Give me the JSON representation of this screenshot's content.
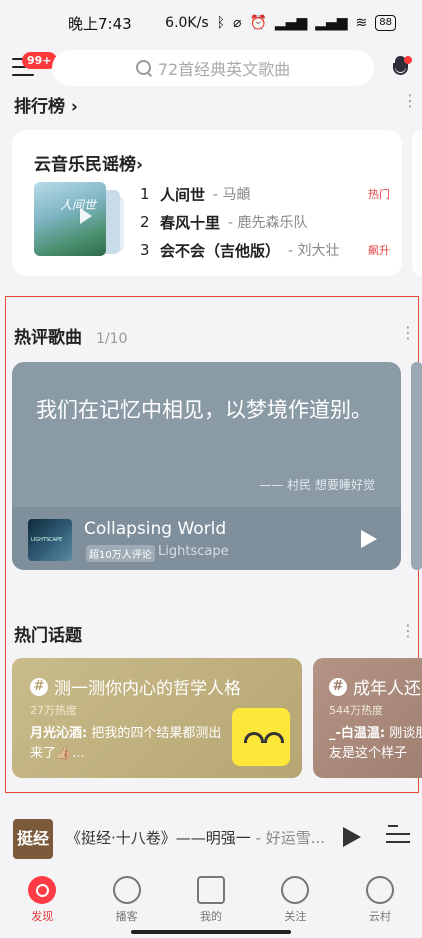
{
  "status": {
    "time": "晚上7:43",
    "speed": "6.0K/s",
    "battery": "88",
    "icons": [
      "bluetooth-icon",
      "mute-icon",
      "alarm-icon",
      "signal-icon",
      "signal-icon",
      "wifi-icon"
    ]
  },
  "header": {
    "badge": "99+",
    "search_placeholder": "72首经典英文歌曲"
  },
  "ranking": {
    "section_title": "排行榜 ›",
    "card_title": "云音乐民谣榜›",
    "cover_text": "人间世",
    "rows": [
      {
        "num": "1",
        "song": "人间世",
        "artist": "- 马頔",
        "tag": "热门"
      },
      {
        "num": "2",
        "song": "春风十里",
        "artist": "- 鹿先森乐队",
        "tag": ""
      },
      {
        "num": "3",
        "song": "会不会（吉他版）",
        "artist": "- 刘大壮",
        "tag": "飙升"
      }
    ]
  },
  "hot_comments": {
    "title": "热评歌曲",
    "page": "1/10",
    "comment": "我们在记忆中相见，以梦境作道别。",
    "author": "—— 村民 想要睡好觉",
    "song_title": "Collapsing World",
    "song_badge": "超10万人评论",
    "song_artist": "Lightscape"
  },
  "hot_topics": {
    "title": "热门话题",
    "cards": [
      {
        "title": "测一测你内心的哲学人格",
        "heat": "27万热度",
        "user": "月光沁酒:",
        "comment": "把我的四个结果都测出来了👍🏼..."
      },
      {
        "title": "成年人还",
        "heat": "544万热度",
        "user": "_-白温温:",
        "comment": "刚谈朋友是这个样子"
      }
    ]
  },
  "player": {
    "cover_text": "挺经",
    "title": "《挺经·十八卷》——明强一",
    "artist": " - 好运雪..."
  },
  "tabs": [
    {
      "label": "发现",
      "active": true
    },
    {
      "label": "播客",
      "active": false
    },
    {
      "label": "我的",
      "active": false
    },
    {
      "label": "关注",
      "active": false
    },
    {
      "label": "云村",
      "active": false
    }
  ],
  "colors": {
    "accent": "#ff3b45",
    "highlight_border": "#e34a3a"
  }
}
